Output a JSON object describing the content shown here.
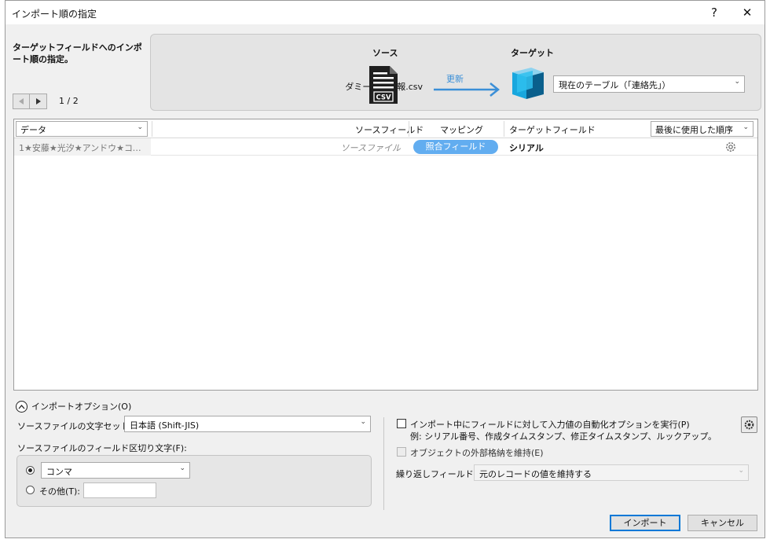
{
  "window": {
    "title": "インポート順の指定",
    "help_label": "?",
    "close_label": "✕"
  },
  "header": {
    "description": "ターゲットフィールドへのインポート順の指定。",
    "page_indicator": "1 / 2",
    "source_label": "ソース",
    "source_file": "ダミー個人情報.csv",
    "csv_badge": "CSV",
    "update_label": "更新",
    "target_label": "ターゲット",
    "target_table": "現在のテーブル（「連絡先」）"
  },
  "table": {
    "data_select": "データ",
    "col_source": "ソースフィールド",
    "col_mapping": "マッピング",
    "col_target": "ターゲットフィールド",
    "order_select": "最後に使用した順序",
    "rows": [
      {
        "data": "1★安藤★光汐★アンドウ★コウガ…",
        "source": "ソースファイル",
        "mapping": "照合フィールド",
        "target": "シリアル"
      }
    ]
  },
  "options": {
    "toggle_label": "インポートオプション(O)",
    "charset_label": "ソースファイルの文字セット(C):",
    "charset_value": "日本語 (Shift-JIS)",
    "delimiter_label": "ソースファイルのフィールド区切り文字(F):",
    "delimiter_comma": "コンマ",
    "delimiter_other": "その他(T):",
    "auto_enter_label": "インポート中にフィールドに対して入力値の自動化オプションを実行(P)",
    "auto_enter_example": "例: シリアル番号、作成タイムスタンプ、修正タイムスタンプ、ルックアップ。",
    "external_storage_label": "オブジェクトの外部格納を維持(E)",
    "repeat_label": "繰り返しフィールド(R):",
    "repeat_value": "元のレコードの値を維持する"
  },
  "buttons": {
    "import": "インポート",
    "cancel": "キャンセル"
  },
  "colors": {
    "accent": "#0078d7",
    "mapping_pill": "#62adf0",
    "arrow": "#3b8fd7"
  }
}
